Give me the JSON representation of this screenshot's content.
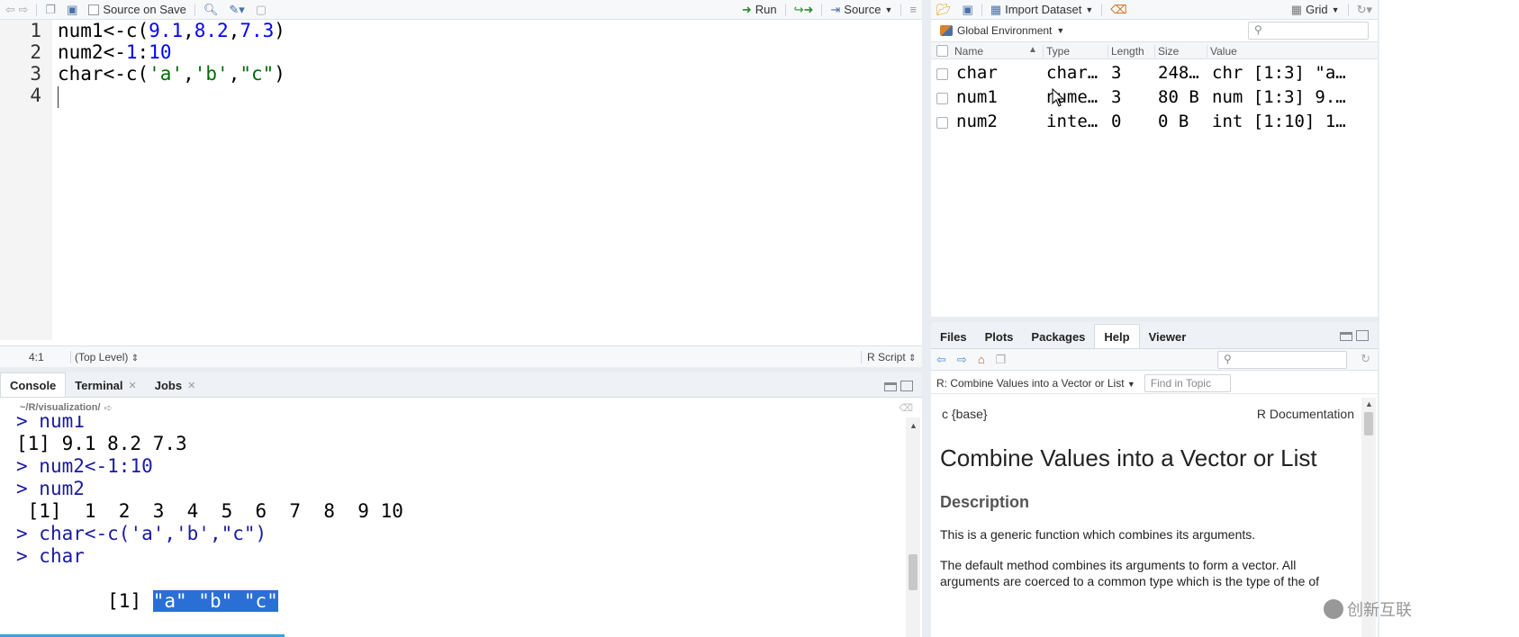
{
  "editor": {
    "toolbar": {
      "source_on_save": "Source on Save",
      "run": "Run",
      "source": "Source"
    },
    "lines": [
      {
        "no": "1",
        "parts": [
          {
            "t": "num1<-c(",
            "c": "plain"
          },
          {
            "t": "9.1",
            "c": "num"
          },
          {
            "t": ",",
            "c": "plain"
          },
          {
            "t": "8.2",
            "c": "num"
          },
          {
            "t": ",",
            "c": "plain"
          },
          {
            "t": "7.3",
            "c": "num"
          },
          {
            "t": ")",
            "c": "plain"
          }
        ]
      },
      {
        "no": "2",
        "parts": [
          {
            "t": "num2<-",
            "c": "plain"
          },
          {
            "t": "1",
            "c": "num"
          },
          {
            "t": ":",
            "c": "plain"
          },
          {
            "t": "10",
            "c": "num"
          }
        ]
      },
      {
        "no": "3",
        "parts": [
          {
            "t": "char<-c(",
            "c": "plain"
          },
          {
            "t": "'a'",
            "c": "str"
          },
          {
            "t": ",",
            "c": "plain"
          },
          {
            "t": "'b'",
            "c": "str"
          },
          {
            "t": ",",
            "c": "plain"
          },
          {
            "t": "\"c\"",
            "c": "str"
          },
          {
            "t": ")",
            "c": "plain"
          }
        ]
      },
      {
        "no": "4",
        "parts": []
      }
    ],
    "status": {
      "position": "4:1",
      "scope": "(Top Level)",
      "filetype": "R Script"
    }
  },
  "console": {
    "tabs": [
      "Console",
      "Terminal",
      "Jobs"
    ],
    "path": "~/R/visualization/",
    "lines": [
      {
        "prompt": ">",
        "text": "num1",
        "kind": "input"
      },
      {
        "prompt": "",
        "text": "[1] 9.1 8.2 7.3",
        "kind": "output"
      },
      {
        "prompt": ">",
        "text": "num2<-1:10",
        "kind": "input"
      },
      {
        "prompt": ">",
        "text": "num2",
        "kind": "input"
      },
      {
        "prompt": "",
        "text": " [1]  1  2  3  4  5  6  7  8  9 10",
        "kind": "output"
      },
      {
        "prompt": ">",
        "text": "char<-c('a','b',\"c\")",
        "kind": "input"
      },
      {
        "prompt": ">",
        "text": "char",
        "kind": "input"
      }
    ],
    "last_line": {
      "prefix": "[1] ",
      "selected": "\"a\" \"b\" \"c\""
    }
  },
  "environment": {
    "toolbar": {
      "import": "Import Dataset",
      "view": "Grid"
    },
    "scope": "Global Environment",
    "columns": [
      "Name",
      "Type",
      "Length",
      "Size",
      "Value"
    ],
    "rows": [
      {
        "name": "char",
        "type": "char…",
        "length": "3",
        "size": "248…",
        "value": "chr [1:3] \"a…"
      },
      {
        "name": "num1",
        "type": "nume…",
        "length": "3",
        "size": "80 B",
        "value": "num [1:3] 9.…"
      },
      {
        "name": "num2",
        "type": "inte…",
        "length": "0",
        "size": "0 B",
        "value": "int [1:10] 1…"
      }
    ]
  },
  "help": {
    "tabs": [
      "Files",
      "Plots",
      "Packages",
      "Help",
      "Viewer"
    ],
    "active_tab": "Help",
    "topic_select": "R: Combine Values into a Vector or List",
    "find_placeholder": "Find in Topic",
    "pkg": "c {base}",
    "doc_label": "R Documentation",
    "title": "Combine Values into a Vector or List",
    "description_heading": "Description",
    "para1": "This is a generic function which combines its arguments.",
    "para2_line1": "The default method combines its arguments to form a vector. All",
    "para2_line2": "arguments are coerced to a common type which is the type of the of"
  },
  "watermark": "创新互联"
}
